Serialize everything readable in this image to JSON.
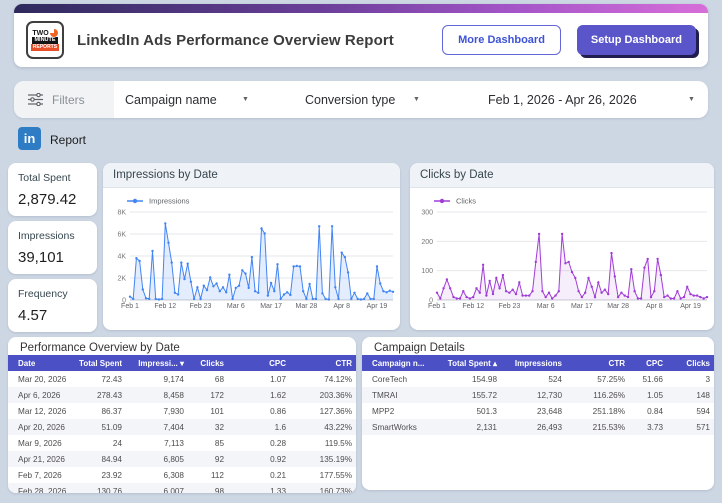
{
  "header": {
    "logo": {
      "line1": "TWO",
      "line2": "MINUTE",
      "line3": "REPORTS"
    },
    "title": "LinkedIn Ads Performance Overview Report",
    "more_button": "More Dashboard",
    "setup_button": "Setup Dashboard"
  },
  "filters": {
    "label": "Filters",
    "campaign_filter": "Campaign name",
    "conversion_filter": "Conversion type",
    "date_range": "Feb 1, 2026 - Apr 26, 2026"
  },
  "report": {
    "label": "Report",
    "linkedin_icon": "in"
  },
  "kpis": [
    {
      "label": "Total Spent",
      "value": "2,879.42"
    },
    {
      "label": "Impressions",
      "value": "39,101"
    },
    {
      "label": "Frequency",
      "value": "4.57"
    }
  ],
  "colors": {
    "impressions_line": "#4285f4",
    "clicks_line": "#a13dd6",
    "table_header": "#4b50c4",
    "accent_purple": "#5a55c8",
    "gradient_left": "#2e2a5c",
    "gradient_right": "#d76ed9"
  },
  "chart_data": [
    {
      "type": "line",
      "title": "Impressions by Date",
      "legend": "Impressions",
      "color": "#4285f4",
      "fill": "rgba(66,133,244,0.15)",
      "ylim": [
        0,
        8000
      ],
      "yticks": [
        {
          "v": 0,
          "label": "0"
        },
        {
          "v": 2000,
          "label": "2K"
        },
        {
          "v": 4000,
          "label": "4K"
        },
        {
          "v": 6000,
          "label": "6K"
        },
        {
          "v": 8000,
          "label": "8K"
        }
      ],
      "xticks": [
        {
          "i": 0,
          "label": "Feb 1"
        },
        {
          "i": 11,
          "label": "Feb 12"
        },
        {
          "i": 22,
          "label": "Feb 23"
        },
        {
          "i": 33,
          "label": "Mar 6"
        },
        {
          "i": 44,
          "label": "Mar 17"
        },
        {
          "i": 55,
          "label": "Mar 28"
        },
        {
          "i": 66,
          "label": "Apr 8"
        },
        {
          "i": 77,
          "label": "Apr 19"
        }
      ],
      "values": [
        300,
        100,
        3800,
        3550,
        950,
        150,
        100,
        4450,
        100,
        50,
        100,
        6950,
        5200,
        3400,
        650,
        500,
        3400,
        1900,
        3300,
        1650,
        100,
        1150,
        100,
        1300,
        900,
        2050,
        1250,
        1500,
        800,
        1150,
        700,
        2300,
        100,
        1100,
        1300,
        2700,
        2400,
        1100,
        3900,
        800,
        650,
        6500,
        6050,
        400,
        1550,
        800,
        3250,
        100,
        500,
        700,
        450,
        3050,
        3100,
        3050,
        800,
        100,
        1450,
        100,
        100,
        6700,
        600,
        100,
        50,
        6700,
        1150,
        100,
        4300,
        3900,
        2500,
        100,
        650,
        100,
        50,
        100,
        600,
        100,
        100,
        3050,
        1500,
        800,
        700,
        850,
        750
      ]
    },
    {
      "type": "line",
      "title": "Clicks by Date",
      "legend": "Clicks",
      "color": "#a13dd6",
      "fill": "rgba(161,61,214,0.09)",
      "ylim": [
        0,
        300
      ],
      "yticks": [
        {
          "v": 0,
          "label": "0"
        },
        {
          "v": 100,
          "label": "100"
        },
        {
          "v": 200,
          "label": "200"
        },
        {
          "v": 300,
          "label": "300"
        }
      ],
      "xticks": [
        {
          "i": 0,
          "label": "Feb 1"
        },
        {
          "i": 11,
          "label": "Feb 12"
        },
        {
          "i": 22,
          "label": "Feb 23"
        },
        {
          "i": 33,
          "label": "Mar 6"
        },
        {
          "i": 44,
          "label": "Mar 17"
        },
        {
          "i": 55,
          "label": "Mar 28"
        },
        {
          "i": 66,
          "label": "Apr 8"
        },
        {
          "i": 77,
          "label": "Apr 19"
        }
      ],
      "values": [
        25,
        5,
        40,
        70,
        40,
        10,
        5,
        5,
        30,
        10,
        5,
        10,
        40,
        25,
        120,
        15,
        65,
        20,
        75,
        40,
        85,
        30,
        25,
        35,
        20,
        60,
        15,
        15,
        15,
        30,
        130,
        225,
        30,
        10,
        25,
        5,
        15,
        30,
        225,
        125,
        130,
        95,
        75,
        30,
        10,
        25,
        75,
        45,
        10,
        60,
        25,
        35,
        20,
        160,
        80,
        10,
        25,
        15,
        10,
        105,
        30,
        5,
        5,
        110,
        140,
        10,
        30,
        140,
        85,
        10,
        15,
        5,
        5,
        30,
        5,
        10,
        45,
        20,
        15,
        15,
        10,
        5,
        10
      ]
    }
  ],
  "tables": {
    "performance": {
      "title": "Performance Overview by Date",
      "columns": [
        "Date",
        "Total Spent",
        "Impressi...",
        "Clicks",
        "CPC",
        "CTR"
      ],
      "sort_column_index": 2,
      "sort_direction": "desc",
      "rows": [
        [
          "Mar 20, 2026",
          "72.43",
          "9,174",
          "68",
          "1.07",
          "74.12%"
        ],
        [
          "Apr 6, 2026",
          "278.43",
          "8,458",
          "172",
          "1.62",
          "203.36%"
        ],
        [
          "Mar 12, 2026",
          "86.37",
          "7,930",
          "101",
          "0.86",
          "127.36%"
        ],
        [
          "Apr 20, 2026",
          "51.09",
          "7,404",
          "32",
          "1.6",
          "43.22%"
        ],
        [
          "Mar 9, 2026",
          "24",
          "7,113",
          "85",
          "0.28",
          "119.5%"
        ],
        [
          "Apr 21, 2026",
          "84.94",
          "6,805",
          "92",
          "0.92",
          "135.19%"
        ],
        [
          "Feb 7, 2026",
          "23.92",
          "6,308",
          "112",
          "0.21",
          "177.55%"
        ],
        [
          "Feb 28, 2026",
          "130.76",
          "6,007",
          "98",
          "1.33",
          "160.73%"
        ]
      ]
    },
    "campaign": {
      "title": "Campaign Details",
      "columns": [
        "Campaign n...",
        "Total Spent",
        "Impressions",
        "CTR",
        "CPC",
        "Clicks"
      ],
      "sort_column_index": 1,
      "sort_direction": "asc",
      "rows": [
        [
          "CoreTech",
          "154.98",
          "524",
          "57.25%",
          "51.66",
          "3"
        ],
        [
          "TMRAI",
          "155.72",
          "12,730",
          "116.26%",
          "1.05",
          "148"
        ],
        [
          "MPP2",
          "501.3",
          "23,648",
          "251.18%",
          "0.84",
          "594"
        ],
        [
          "SmartWorks",
          "2,131",
          "26,493",
          "215.53%",
          "3.73",
          "571"
        ]
      ]
    }
  }
}
